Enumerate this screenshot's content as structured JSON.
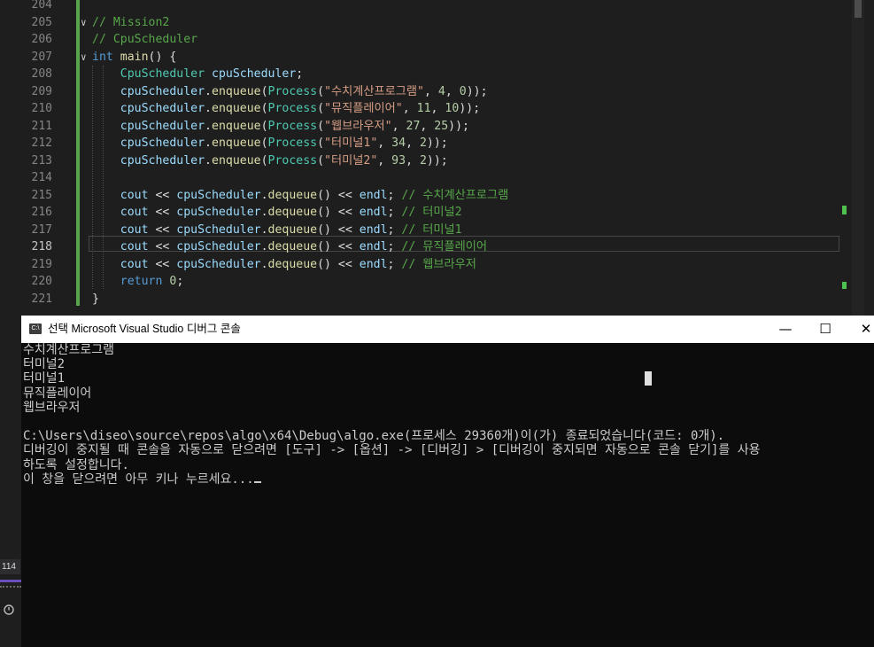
{
  "editor": {
    "lines": [
      {
        "num": "204",
        "tokens": []
      },
      {
        "num": "205",
        "fold": "∨",
        "tokens": [
          {
            "c": "syn-cmt",
            "t": "// Mission2"
          }
        ]
      },
      {
        "num": "206",
        "tokens": [
          {
            "c": "syn-cmt",
            "t": "// CpuScheduler"
          }
        ]
      },
      {
        "num": "207",
        "fold": "∨",
        "tokens": [
          {
            "c": "syn-kw",
            "t": "int"
          },
          {
            "c": "syn-p",
            "t": " "
          },
          {
            "c": "syn-fn",
            "t": "main"
          },
          {
            "c": "syn-p",
            "t": "() {"
          }
        ]
      },
      {
        "num": "208",
        "tokens": [
          {
            "c": "syn-p",
            "t": "    "
          },
          {
            "c": "syn-type",
            "t": "CpuScheduler"
          },
          {
            "c": "syn-p",
            "t": " "
          },
          {
            "c": "syn-var",
            "t": "cpuScheduler"
          },
          {
            "c": "syn-p",
            "t": ";"
          }
        ]
      },
      {
        "num": "209",
        "tokens": [
          {
            "c": "syn-p",
            "t": "    "
          },
          {
            "c": "syn-var",
            "t": "cpuScheduler"
          },
          {
            "c": "syn-p",
            "t": "."
          },
          {
            "c": "syn-fn",
            "t": "enqueue"
          },
          {
            "c": "syn-p",
            "t": "("
          },
          {
            "c": "syn-type",
            "t": "Process"
          },
          {
            "c": "syn-p",
            "t": "("
          },
          {
            "c": "syn-str",
            "t": "\"수치계산프로그램\""
          },
          {
            "c": "syn-p",
            "t": ", "
          },
          {
            "c": "syn-num",
            "t": "4"
          },
          {
            "c": "syn-p",
            "t": ", "
          },
          {
            "c": "syn-num",
            "t": "0"
          },
          {
            "c": "syn-p",
            "t": "));"
          }
        ]
      },
      {
        "num": "210",
        "tokens": [
          {
            "c": "syn-p",
            "t": "    "
          },
          {
            "c": "syn-var",
            "t": "cpuScheduler"
          },
          {
            "c": "syn-p",
            "t": "."
          },
          {
            "c": "syn-fn",
            "t": "enqueue"
          },
          {
            "c": "syn-p",
            "t": "("
          },
          {
            "c": "syn-type",
            "t": "Process"
          },
          {
            "c": "syn-p",
            "t": "("
          },
          {
            "c": "syn-str",
            "t": "\"뮤직플레이어\""
          },
          {
            "c": "syn-p",
            "t": ", "
          },
          {
            "c": "syn-num",
            "t": "11"
          },
          {
            "c": "syn-p",
            "t": ", "
          },
          {
            "c": "syn-num",
            "t": "10"
          },
          {
            "c": "syn-p",
            "t": "));"
          }
        ]
      },
      {
        "num": "211",
        "tokens": [
          {
            "c": "syn-p",
            "t": "    "
          },
          {
            "c": "syn-var",
            "t": "cpuScheduler"
          },
          {
            "c": "syn-p",
            "t": "."
          },
          {
            "c": "syn-fn",
            "t": "enqueue"
          },
          {
            "c": "syn-p",
            "t": "("
          },
          {
            "c": "syn-type",
            "t": "Process"
          },
          {
            "c": "syn-p",
            "t": "("
          },
          {
            "c": "syn-str",
            "t": "\"웹브라우저\""
          },
          {
            "c": "syn-p",
            "t": ", "
          },
          {
            "c": "syn-num",
            "t": "27"
          },
          {
            "c": "syn-p",
            "t": ", "
          },
          {
            "c": "syn-num",
            "t": "25"
          },
          {
            "c": "syn-p",
            "t": "));"
          }
        ]
      },
      {
        "num": "212",
        "tokens": [
          {
            "c": "syn-p",
            "t": "    "
          },
          {
            "c": "syn-var",
            "t": "cpuScheduler"
          },
          {
            "c": "syn-p",
            "t": "."
          },
          {
            "c": "syn-fn",
            "t": "enqueue"
          },
          {
            "c": "syn-p",
            "t": "("
          },
          {
            "c": "syn-type",
            "t": "Process"
          },
          {
            "c": "syn-p",
            "t": "("
          },
          {
            "c": "syn-str",
            "t": "\"터미널1\""
          },
          {
            "c": "syn-p",
            "t": ", "
          },
          {
            "c": "syn-num",
            "t": "34"
          },
          {
            "c": "syn-p",
            "t": ", "
          },
          {
            "c": "syn-num",
            "t": "2"
          },
          {
            "c": "syn-p",
            "t": "));"
          }
        ]
      },
      {
        "num": "213",
        "tokens": [
          {
            "c": "syn-p",
            "t": "    "
          },
          {
            "c": "syn-var",
            "t": "cpuScheduler"
          },
          {
            "c": "syn-p",
            "t": "."
          },
          {
            "c": "syn-fn",
            "t": "enqueue"
          },
          {
            "c": "syn-p",
            "t": "("
          },
          {
            "c": "syn-type",
            "t": "Process"
          },
          {
            "c": "syn-p",
            "t": "("
          },
          {
            "c": "syn-str",
            "t": "\"터미널2\""
          },
          {
            "c": "syn-p",
            "t": ", "
          },
          {
            "c": "syn-num",
            "t": "93"
          },
          {
            "c": "syn-p",
            "t": ", "
          },
          {
            "c": "syn-num",
            "t": "2"
          },
          {
            "c": "syn-p",
            "t": "));"
          }
        ]
      },
      {
        "num": "214",
        "tokens": []
      },
      {
        "num": "215",
        "tokens": [
          {
            "c": "syn-p",
            "t": "    "
          },
          {
            "c": "syn-var",
            "t": "cout"
          },
          {
            "c": "syn-p",
            "t": " << "
          },
          {
            "c": "syn-var",
            "t": "cpuScheduler"
          },
          {
            "c": "syn-p",
            "t": "."
          },
          {
            "c": "syn-fn",
            "t": "dequeue"
          },
          {
            "c": "syn-p",
            "t": "() << "
          },
          {
            "c": "syn-var",
            "t": "endl"
          },
          {
            "c": "syn-p",
            "t": "; "
          },
          {
            "c": "syn-cmt",
            "t": "// 수치계산프로그램"
          }
        ]
      },
      {
        "num": "216",
        "tokens": [
          {
            "c": "syn-p",
            "t": "    "
          },
          {
            "c": "syn-var",
            "t": "cout"
          },
          {
            "c": "syn-p",
            "t": " << "
          },
          {
            "c": "syn-var",
            "t": "cpuScheduler"
          },
          {
            "c": "syn-p",
            "t": "."
          },
          {
            "c": "syn-fn",
            "t": "dequeue"
          },
          {
            "c": "syn-p",
            "t": "() << "
          },
          {
            "c": "syn-var",
            "t": "endl"
          },
          {
            "c": "syn-p",
            "t": "; "
          },
          {
            "c": "syn-cmt",
            "t": "// 터미널2"
          }
        ]
      },
      {
        "num": "217",
        "tokens": [
          {
            "c": "syn-p",
            "t": "    "
          },
          {
            "c": "syn-var",
            "t": "cout"
          },
          {
            "c": "syn-p",
            "t": " << "
          },
          {
            "c": "syn-var",
            "t": "cpuScheduler"
          },
          {
            "c": "syn-p",
            "t": "."
          },
          {
            "c": "syn-fn",
            "t": "dequeue"
          },
          {
            "c": "syn-p",
            "t": "() << "
          },
          {
            "c": "syn-var",
            "t": "endl"
          },
          {
            "c": "syn-p",
            "t": "; "
          },
          {
            "c": "syn-cmt",
            "t": "// 터미널1"
          }
        ]
      },
      {
        "num": "218",
        "current": true,
        "tokens": [
          {
            "c": "syn-p",
            "t": "    "
          },
          {
            "c": "syn-var",
            "t": "cout"
          },
          {
            "c": "syn-p",
            "t": " << "
          },
          {
            "c": "syn-var",
            "t": "cpuScheduler"
          },
          {
            "c": "syn-p",
            "t": "."
          },
          {
            "c": "syn-fn",
            "t": "dequeue"
          },
          {
            "c": "syn-p",
            "t": "() << "
          },
          {
            "c": "syn-var",
            "t": "endl"
          },
          {
            "c": "syn-p",
            "t": "; "
          },
          {
            "c": "syn-cmt",
            "t": "// 뮤직플레이어"
          }
        ]
      },
      {
        "num": "219",
        "tokens": [
          {
            "c": "syn-p",
            "t": "    "
          },
          {
            "c": "syn-var",
            "t": "cout"
          },
          {
            "c": "syn-p",
            "t": " << "
          },
          {
            "c": "syn-var",
            "t": "cpuScheduler"
          },
          {
            "c": "syn-p",
            "t": "."
          },
          {
            "c": "syn-fn",
            "t": "dequeue"
          },
          {
            "c": "syn-p",
            "t": "() << "
          },
          {
            "c": "syn-var",
            "t": "endl"
          },
          {
            "c": "syn-p",
            "t": "; "
          },
          {
            "c": "syn-cmt",
            "t": "// 웹브라우저"
          }
        ]
      },
      {
        "num": "220",
        "tokens": [
          {
            "c": "syn-p",
            "t": "    "
          },
          {
            "c": "syn-kw",
            "t": "return"
          },
          {
            "c": "syn-p",
            "t": " "
          },
          {
            "c": "syn-num",
            "t": "0"
          },
          {
            "c": "syn-p",
            "t": ";"
          }
        ]
      },
      {
        "num": "221",
        "tokens": [
          {
            "c": "syn-p",
            "t": "}"
          }
        ]
      }
    ],
    "side_badge": "114"
  },
  "console": {
    "title": "선택 Microsoft Visual Studio 디버그 콘솔",
    "icon_text": "C:\\",
    "minimize": "—",
    "maximize": "☐",
    "close": "✕",
    "lines": [
      "수치계산프로그램",
      "터미널2",
      "터미널1",
      "뮤직플레이어",
      "웹브라우저",
      "",
      "C:\\Users\\diseo\\source\\repos\\algo\\x64\\Debug\\algo.exe(프로세스 29360개)이(가) 종료되었습니다(코드: 0개).",
      "디버깅이 중지될 때 콘솔을 자동으로 닫으려면 [도구] -> [옵션] -> [디버깅] > [디버깅이 중지되면 자동으로 콘솔 닫기]를 사용",
      "하도록 설정합니다.",
      "이 창을 닫으려면 아무 키나 누르세요..."
    ]
  },
  "colors": {
    "editor_bg": "#1e1e1e",
    "console_bg": "#0c0c0c",
    "change_bar": "#57a64a"
  }
}
